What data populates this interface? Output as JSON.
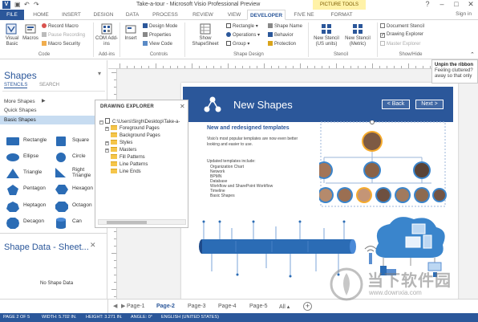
{
  "app": {
    "window_title": "Take-a-tour - Microsoft Visio Professional Preview",
    "app_icon": "V",
    "contextual_tab_group": "PICTURE TOOLS",
    "signin": "Sign in"
  },
  "tabs": [
    "FILE",
    "HOME",
    "INSERT",
    "DESIGN",
    "DATA",
    "PROCESS",
    "REVIEW",
    "VIEW",
    "DEVELOPER",
    "FIVE NE",
    "FORMAT"
  ],
  "ribbon": {
    "code": {
      "visual_basic": "Visual Basic",
      "macros": "Macros",
      "record_macro": "Record Macro",
      "pause_recording": "Pause Recording",
      "macro_security": "Macro Security",
      "group": "Code"
    },
    "addins": {
      "com_addins": "COM Add-ins",
      "group": "Add-ins"
    },
    "controls": {
      "insert": "Insert",
      "design_mode": "Design Mode",
      "properties": "Properties",
      "view_code": "View Code",
      "group": "Controls"
    },
    "shape_design": {
      "show_shapesheet": "Show ShapeSheet",
      "rectangle": "Rectangle",
      "operations": "Operations",
      "group_btn": "Group",
      "shape_name": "Shape Name",
      "behavior": "Behavior",
      "protection": "Protection",
      "group": "Shape Design"
    },
    "stencil": {
      "new_stencil_us": "New Stencil (US units)",
      "new_stencil_metric": "New Stencil (Metric)",
      "group": "Stencil"
    },
    "show_hide": {
      "document_stencil": "Document Stencil",
      "drawing_explorer": "Drawing Explorer",
      "master_explorer": "Master Explorer",
      "group": "Show/Hide"
    }
  },
  "tooltip": {
    "title": "Unpin the ribbon",
    "body": "Feeling cluttered? away so that only"
  },
  "shapes_pane": {
    "title": "Shapes",
    "tab_stencils": "STENCILS",
    "tab_search": "SEARCH",
    "nav_items": [
      "More Shapes",
      "Quick Shapes",
      "Basic Shapes"
    ],
    "selected_item": "Basic Shapes",
    "shapes": [
      "Rectangle",
      "Square",
      "Ellipse",
      "Circle",
      "Triangle",
      "Right Triangle",
      "Pentagon",
      "Hexagon",
      "Heptagon",
      "Octagon",
      "Decagon",
      "Can"
    ]
  },
  "drawing_explorer": {
    "title": "DRAWING EXPLORER",
    "root": "C:\\Users\\Sirgh\\Desktop\\Take-a-",
    "nodes": [
      "Foreground Pages",
      "Background Pages",
      "Styles",
      "Masters",
      "Fill Patterns",
      "Line Patterns",
      "Line Ends"
    ]
  },
  "shape_data": {
    "title": "Shape Data - Sheet...",
    "empty": "No Shape Data"
  },
  "document": {
    "banner_title": "New Shapes",
    "back_button": "< Back",
    "next_button": "Next >",
    "subtitle": "New and redesigned templates",
    "intro": "Visio's most popular templates are now even better looking and easier to use.",
    "list_heading": "Updated templates include:",
    "list": [
      "Organization Chart",
      "Network",
      "BPMN",
      "Database",
      "Workflow and SharePoint Workflow",
      "Timeline",
      "Basic Shapes"
    ]
  },
  "page_tabs": [
    "Page-1",
    "Page-2",
    "Page-3",
    "Page-4",
    "Page-5",
    "All"
  ],
  "active_page": "Page-2",
  "status_bar": {
    "page": "PAGE 2 OF 5",
    "width": "WIDTH: 5.702 IN.",
    "height": "HEIGHT: 3.271 IN.",
    "angle": "ANGLE: 0°",
    "language": "ENGLISH (UNITED STATES)"
  },
  "watermark": {
    "brand": "当下软件园",
    "url": "www.downxia.com"
  },
  "colors": {
    "accent": "#2b579a",
    "selected": "#c7dcf1",
    "shape_fill": "#2b6cb5",
    "tab_active": "#2b579a"
  }
}
